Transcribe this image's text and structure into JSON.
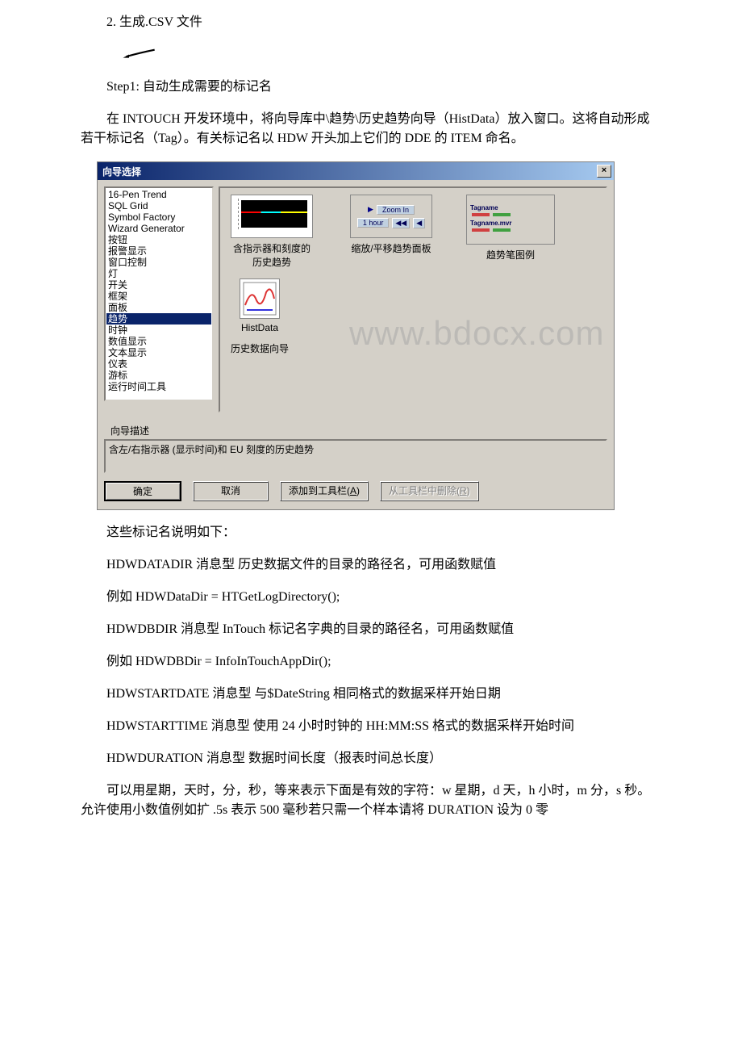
{
  "doc": {
    "p1": "2. 生成.CSV 文件",
    "p2": "Step1: 自动生成需要的标记名",
    "p3": "在 INTOUCH 开发环境中，将向导库中\\趋势\\历史趋势向导（HistData）放入窗口。这将自动形成若干标记名（Tag）。有关标记名以 HDW 开头加上它们的 DDE 的 ITEM 命名。",
    "p4": "这些标记名说明如下：",
    "p5": "HDWDATADIR 消息型 历史数据文件的目录的路径名，可用函数赋值",
    "p6": "例如 HDWDataDir = HTGetLogDirectory();",
    "p7": "HDWDBDIR 消息型 InTouch 标记名字典的目录的路径名，可用函数赋值",
    "p8": "例如 HDWDBDir = InfoInTouchAppDir();",
    "p9": "HDWSTARTDATE 消息型 与$DateString 相同格式的数据采样开始日期",
    "p10": "HDWSTARTTIME 消息型 使用 24 小时时钟的 HH:MM:SS 格式的数据采样开始时间",
    "p11": "HDWDURATION 消息型 数据时间长度（报表时间总长度）",
    "p12": "可以用星期，天时，分，秒，等来表示下面是有效的字符：w 星期，d 天，h 小时，m 分，s 秒。允许使用小数值例如扩 .5s 表示 500 毫秒若只需一个样本请将 DURATION 设为 0 零"
  },
  "dialog": {
    "title": "向导选择",
    "close": "×",
    "list": [
      {
        "label": "16-Pen Trend",
        "selected": false
      },
      {
        "label": "SQL Grid",
        "selected": false
      },
      {
        "label": "Symbol Factory",
        "selected": false
      },
      {
        "label": "Wizard Generator",
        "selected": false
      },
      {
        "label": "按钮",
        "selected": false
      },
      {
        "label": "报警显示",
        "selected": false
      },
      {
        "label": "窗口控制",
        "selected": false
      },
      {
        "label": "灯",
        "selected": false
      },
      {
        "label": "开关",
        "selected": false
      },
      {
        "label": "框架",
        "selected": false
      },
      {
        "label": "面板",
        "selected": false
      },
      {
        "label": "趋势",
        "selected": true
      },
      {
        "label": "时钟",
        "selected": false
      },
      {
        "label": "数值显示",
        "selected": false
      },
      {
        "label": "文本显示",
        "selected": false
      },
      {
        "label": "仪表",
        "selected": false
      },
      {
        "label": "游标",
        "selected": false
      },
      {
        "label": "运行时间工具",
        "selected": false
      }
    ],
    "previews": {
      "r1c1_line1": "含指示器和刻度的",
      "r1c1_line2": "历史趋势",
      "r1c2": "缩放/平移趋势面板",
      "r1c3": "趋势笔图例",
      "r2c1_line1": "HistData",
      "r2c1_line2": "历史数据向导",
      "zoom_label": "Zoom In",
      "hour_label": "1 hour",
      "legend_t1": "Tagname",
      "legend_t2": "Tagname.mvr"
    },
    "desc_label": "向导描述",
    "desc_text": "含左/右指示器 (显示时间)和 EU 刻度的历史趋势",
    "buttons": {
      "ok": "确定",
      "cancel": "取消",
      "add_pre": "添加到工具栏(",
      "add_key": "A",
      "add_post": ")",
      "del_pre": "从工具栏中删除(",
      "del_key": "R",
      "del_post": ")"
    },
    "watermark": "www.bdocx.com"
  }
}
